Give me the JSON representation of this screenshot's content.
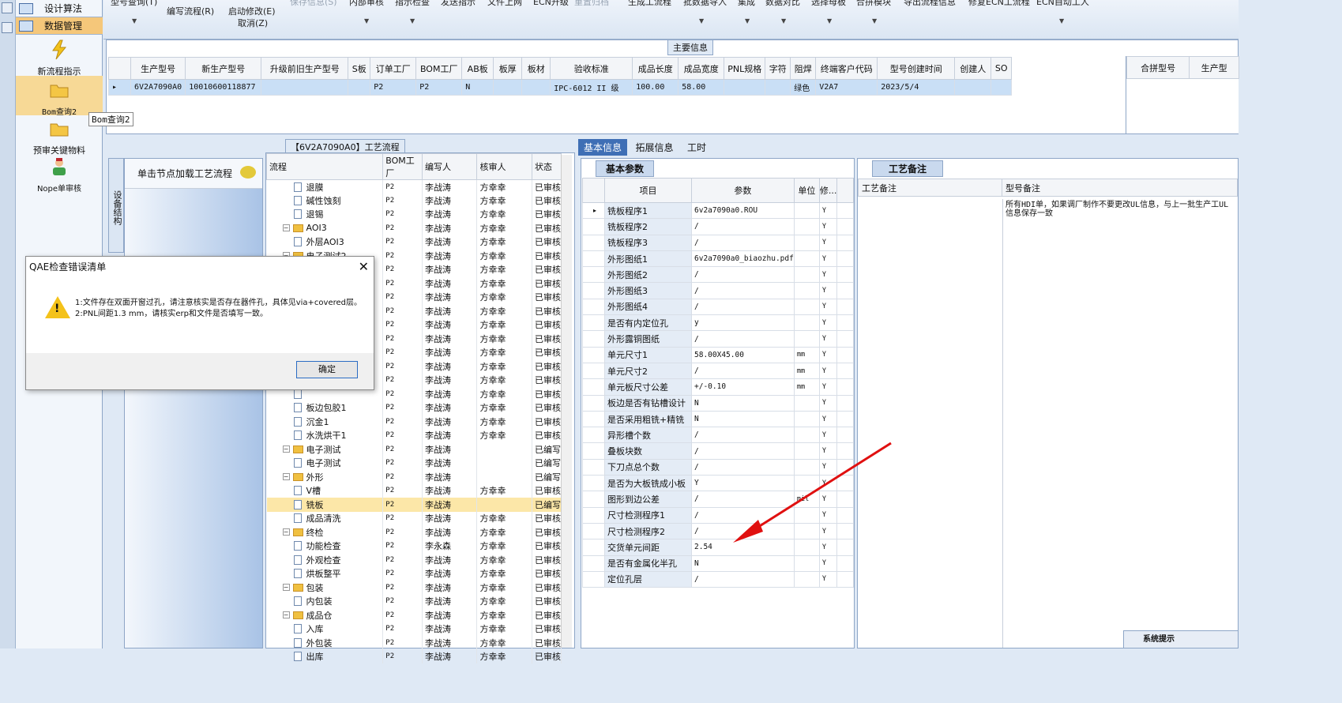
{
  "sidebar": {
    "top_items": [
      "设计算法",
      "数据管理"
    ],
    "items": [
      "新流程指示",
      "Bom查询2",
      "预审关键物料",
      "Nope单审核"
    ],
    "tooltip": "Bom查询2"
  },
  "toolbar": {
    "row1": [
      "型号查询(T)",
      "保存信息(S)",
      "内部审核",
      "指示检查",
      "发送指示",
      "文件上网",
      "ECN升级",
      "重置归档",
      "生成工流程",
      "批数据导入",
      "集成",
      "数据对比",
      "选择母板",
      "合拼模块",
      "导出流程信息",
      "修复ECN工流程",
      "ECN自动工人"
    ],
    "edit_flow": "编写流程(R)",
    "start_modify": "启动修改(E)",
    "cancel": "取消(Z)"
  },
  "main": {
    "tab": "主要信息",
    "columns": [
      "生产型号",
      "新生产型号",
      "升级前旧生产型号",
      "S板",
      "订单工厂",
      "BOM工厂",
      "AB板",
      "板厚",
      "板材",
      "验收标准",
      "成品长度",
      "成品宽度",
      "PNL规格",
      "字符",
      "阻焊",
      "终端客户代码",
      "型号创建时间",
      "创建人",
      "SO"
    ],
    "row": [
      "6V2A7090A0",
      "10010600118877",
      "",
      "",
      "P2",
      "P2",
      "N",
      "",
      "",
      "IPC-6012 II 级",
      "100.00",
      "58.00",
      "",
      "",
      "绿色",
      "V2A7",
      "2023/5/4",
      "",
      ""
    ],
    "right_columns": [
      "合拼型号",
      "生产型"
    ]
  },
  "tree": {
    "title": "【6V2A7090A0】工艺流程",
    "left_tab": "设备结构",
    "left_head": "单击节点加载工艺流程",
    "columns": [
      "流程",
      "BOM工厂",
      "编写人",
      "核审人",
      "状态"
    ],
    "rows": [
      {
        "n": "退膜",
        "t": "d",
        "b": "P2",
        "w": "李战涛",
        "r": "方幸幸",
        "s": "已审核"
      },
      {
        "n": "碱性蚀刻",
        "t": "d",
        "b": "P2",
        "w": "李战涛",
        "r": "方幸幸",
        "s": "已审核"
      },
      {
        "n": "退锡",
        "t": "d",
        "b": "P2",
        "w": "李战涛",
        "r": "方幸幸",
        "s": "已审核"
      },
      {
        "n": "AOI3",
        "t": "f",
        "b": "P2",
        "w": "李战涛",
        "r": "方幸幸",
        "s": "已审核"
      },
      {
        "n": "外层AOI3",
        "t": "d",
        "b": "P2",
        "w": "李战涛",
        "r": "方幸幸",
        "s": "已审核"
      },
      {
        "n": "电子测试2",
        "t": "f",
        "b": "P2",
        "w": "李战涛",
        "r": "方幸幸",
        "s": "已审核"
      },
      {
        "n": "",
        "t": "d",
        "b": "P2",
        "w": "李战涛",
        "r": "方幸幸",
        "s": "已审核"
      },
      {
        "n": "",
        "t": "d",
        "b": "P2",
        "w": "李战涛",
        "r": "方幸幸",
        "s": "已审核"
      },
      {
        "n": "",
        "t": "d",
        "b": "P2",
        "w": "李战涛",
        "r": "方幸幸",
        "s": "已审核"
      },
      {
        "n": "",
        "t": "d",
        "b": "P2",
        "w": "李战涛",
        "r": "方幸幸",
        "s": "已审核"
      },
      {
        "n": "",
        "t": "d",
        "b": "P2",
        "w": "李战涛",
        "r": "方幸幸",
        "s": "已审核"
      },
      {
        "n": "",
        "t": "d",
        "b": "P2",
        "w": "李战涛",
        "r": "方幸幸",
        "s": "已审核"
      },
      {
        "n": "",
        "t": "d",
        "b": "P2",
        "w": "李战涛",
        "r": "方幸幸",
        "s": "已审核"
      },
      {
        "n": "",
        "t": "d",
        "b": "P2",
        "w": "李战涛",
        "r": "方幸幸",
        "s": "已审核"
      },
      {
        "n": "",
        "t": "d",
        "b": "P2",
        "w": "李战涛",
        "r": "方幸幸",
        "s": "已审核"
      },
      {
        "n": "",
        "t": "d",
        "b": "P2",
        "w": "李战涛",
        "r": "方幸幸",
        "s": "已审核"
      },
      {
        "n": "板边包胶1",
        "t": "d",
        "b": "P2",
        "w": "李战涛",
        "r": "方幸幸",
        "s": "已审核"
      },
      {
        "n": "沉金1",
        "t": "d",
        "b": "P2",
        "w": "李战涛",
        "r": "方幸幸",
        "s": "已审核"
      },
      {
        "n": "水洗烘干1",
        "t": "d",
        "b": "P2",
        "w": "李战涛",
        "r": "方幸幸",
        "s": "已审核"
      },
      {
        "n": "电子测试",
        "t": "f",
        "b": "P2",
        "w": "李战涛",
        "r": "",
        "s": "已编写"
      },
      {
        "n": "电子测试",
        "t": "d",
        "b": "P2",
        "w": "李战涛",
        "r": "",
        "s": "已编写"
      },
      {
        "n": "外形",
        "t": "f",
        "b": "P2",
        "w": "李战涛",
        "r": "",
        "s": "已编写"
      },
      {
        "n": "V槽",
        "t": "d",
        "b": "P2",
        "w": "李战涛",
        "r": "方幸幸",
        "s": "已审核"
      },
      {
        "n": "铣板",
        "t": "d",
        "b": "P2",
        "w": "李战涛",
        "r": "",
        "s": "已编写",
        "hl": true
      },
      {
        "n": "成品清洗",
        "t": "d",
        "b": "P2",
        "w": "李战涛",
        "r": "方幸幸",
        "s": "已审核"
      },
      {
        "n": "终检",
        "t": "f",
        "b": "P2",
        "w": "李战涛",
        "r": "方幸幸",
        "s": "已审核"
      },
      {
        "n": "功能检查",
        "t": "d",
        "b": "P2",
        "w": "李永森",
        "r": "方幸幸",
        "s": "已审核"
      },
      {
        "n": "外观检查",
        "t": "d",
        "b": "P2",
        "w": "李战涛",
        "r": "方幸幸",
        "s": "已审核"
      },
      {
        "n": "烘板整平",
        "t": "d",
        "b": "P2",
        "w": "李战涛",
        "r": "方幸幸",
        "s": "已审核"
      },
      {
        "n": "包装",
        "t": "f",
        "b": "P2",
        "w": "李战涛",
        "r": "方幸幸",
        "s": "已审核"
      },
      {
        "n": "内包装",
        "t": "d",
        "b": "P2",
        "w": "李战涛",
        "r": "方幸幸",
        "s": "已审核"
      },
      {
        "n": "成品仓",
        "t": "f",
        "b": "P2",
        "w": "李战涛",
        "r": "方幸幸",
        "s": "已审核"
      },
      {
        "n": "入库",
        "t": "d",
        "b": "P2",
        "w": "李战涛",
        "r": "方幸幸",
        "s": "已审核"
      },
      {
        "n": "外包装",
        "t": "d",
        "b": "P2",
        "w": "李战涛",
        "r": "方幸幸",
        "s": "已审核"
      },
      {
        "n": "出库",
        "t": "d",
        "b": "P2",
        "w": "李战涛",
        "r": "方幸幸",
        "s": "已审核"
      }
    ]
  },
  "right": {
    "tabs": [
      "基本信息",
      "拓展信息",
      "工时"
    ],
    "basic_tab": "基本参数",
    "columns": [
      "项目",
      "参数",
      "单位",
      "修..."
    ],
    "params": [
      [
        "铣板程序1",
        "6v2a7090a0.ROU",
        "",
        "Y"
      ],
      [
        "铣板程序2",
        "/",
        "",
        "Y"
      ],
      [
        "铣板程序3",
        "/",
        "",
        "Y"
      ],
      [
        "外形图纸1",
        "6v2a7090a0_biaozhu.pdf",
        "",
        "Y"
      ],
      [
        "外形图纸2",
        "/",
        "",
        "Y"
      ],
      [
        "外形图纸3",
        "/",
        "",
        "Y"
      ],
      [
        "外形图纸4",
        "/",
        "",
        "Y"
      ],
      [
        "是否有内定位孔",
        "y",
        "",
        "Y"
      ],
      [
        "外形露铜图纸",
        "/",
        "",
        "Y"
      ],
      [
        "单元尺寸1",
        "58.00X45.00",
        "mm",
        "Y"
      ],
      [
        "单元尺寸2",
        "/",
        "mm",
        "Y"
      ],
      [
        "单元板尺寸公差",
        "+/-0.10",
        "mm",
        "Y"
      ],
      [
        "板边是否有钻槽设计",
        "N",
        "",
        "Y"
      ],
      [
        "是否采用粗铣+精铣",
        "N",
        "",
        "Y"
      ],
      [
        "异形槽个数",
        "/",
        "",
        "Y"
      ],
      [
        "叠板块数",
        "/",
        "",
        "Y"
      ],
      [
        "下刀点总个数",
        "/",
        "",
        "Y"
      ],
      [
        "是否为大板铣成小板",
        "Y",
        "",
        "Y"
      ],
      [
        "图形到边公差",
        "/",
        "mil",
        "Y"
      ],
      [
        "尺寸检测程序1",
        "/",
        "",
        "Y"
      ],
      [
        "尺寸检测程序2",
        "/",
        "",
        "Y"
      ],
      [
        "交货单元间距",
        "2.54",
        "",
        "Y"
      ],
      [
        "是否有金属化半孔",
        "N",
        "",
        "Y"
      ],
      [
        "定位孔层",
        "/",
        "",
        "Y"
      ]
    ],
    "proc_tab": "工艺备注",
    "proc_cols": [
      "工艺备注",
      "型号备注"
    ],
    "model_note": "所有HDI单，如果调厂制作不要更改UL信息，与上一批生产工UL信息保存一致"
  },
  "dialog": {
    "title": "QAE检查错误清单",
    "msg1": "1:文件存在双面开窗过孔，请注意核实是否存在器件孔，具体见via+covered层。",
    "msg2": "2:PNL间距1.3 mm，请核实erp和文件是否填写一致。",
    "ok": "确定"
  },
  "sysnote": "系统提示",
  "colors": {
    "accent": "#3f6fb5",
    "highlight": "#fce7a8",
    "selected": "#c9dff6",
    "arrow": "#e01010"
  }
}
